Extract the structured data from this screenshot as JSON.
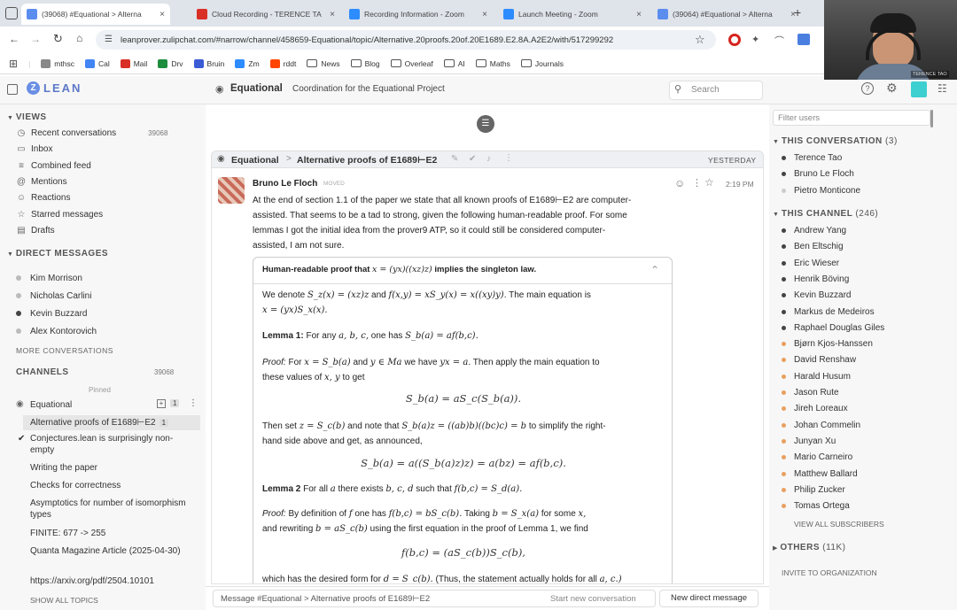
{
  "browser": {
    "tabs": [
      {
        "title": "(39068) #Equational > Alterna",
        "fav": "#5b8def"
      },
      {
        "title": "Cloud Recording - TERENCE TA",
        "fav": "#d93025"
      },
      {
        "title": "Recording Information - Zoom",
        "fav": "#2d8cff"
      },
      {
        "title": "Launch Meeting - Zoom",
        "fav": "#2d8cff"
      },
      {
        "title": "(39064) #Equational > Alterna",
        "fav": "#5b8def"
      }
    ],
    "new_tab": "+",
    "url": "leanprover.zulipchat.com/#narrow/channel/458659-Equational/topic/Alternative.20proofs.20of.20E1689.E2.8A.A2E2/with/517299292",
    "bookmarks": [
      "mthsc",
      "Cal",
      "Mail",
      "Drv",
      "Bruin",
      "Zm",
      "rddt",
      "News",
      "Blog",
      "Overleaf",
      "AI",
      "Maths",
      "Journals"
    ],
    "video_label": "TERENCE TAO"
  },
  "header": {
    "logo": "LEAN",
    "channel": "Equational",
    "description": "Coordination for the Equational Project",
    "search_placeholder": "Search"
  },
  "left": {
    "views_heading": "VIEWS",
    "views": [
      {
        "label": "Recent conversations",
        "icon": "clock-icon",
        "glyph": "◷",
        "count": "39068"
      },
      {
        "label": "Inbox",
        "icon": "inbox-icon",
        "glyph": "▭"
      },
      {
        "label": "Combined feed",
        "icon": "feed-icon",
        "glyph": "≡"
      },
      {
        "label": "Mentions",
        "icon": "at-icon",
        "glyph": "@"
      },
      {
        "label": "Reactions",
        "icon": "smile-icon",
        "glyph": "☺"
      },
      {
        "label": "Starred messages",
        "icon": "star-icon",
        "glyph": "☆"
      },
      {
        "label": "Drafts",
        "icon": "drafts-icon",
        "glyph": "▤"
      }
    ],
    "dm_heading": "DIRECT MESSAGES",
    "dms": [
      {
        "name": "Kim Morrison",
        "status": "#bbb"
      },
      {
        "name": "Nicholas Carlini",
        "status": "#bbb"
      },
      {
        "name": "Kevin Buzzard",
        "status": "#444"
      },
      {
        "name": "Alex Kontorovich",
        "status": "#bbb"
      }
    ],
    "more_conversations": "MORE CONVERSATIONS",
    "channels_heading": "CHANNELS",
    "channels_count": "39068",
    "pinned": "Pinned",
    "channel_name": "Equational",
    "channel_badge": "1",
    "topics": [
      {
        "label": "Alternative proofs of E1689⊢E2",
        "count": "1",
        "active": true
      },
      {
        "label": "Conjectures.lean is surprisingly non-empty",
        "check": true
      },
      {
        "label": "Writing the paper"
      },
      {
        "label": "Checks for correctness"
      },
      {
        "label": "Asymptotics for number of isomorphism types"
      },
      {
        "label": "FINITE: 677 -> 255"
      },
      {
        "label": "Quanta Magazine Article (2025-04-30)"
      },
      {
        "label": "https://arxiv.org/pdf/2504.10101"
      }
    ],
    "show_all_topics": "SHOW ALL TOPICS"
  },
  "center": {
    "recipient_channel": "Equational",
    "recipient_topic": "Alternative proofs of E1689⊢E2",
    "date": "YESTERDAY",
    "sender": "Bruno Le Floch",
    "sender_role": "MOVED",
    "time": "2:19 PM",
    "para1": [
      "At the end of section 1.1 of the paper we state that all known proofs of E1689⊢E2 are computer-",
      "assisted. That seems to be a tad to strong, given the following human-readable proof. For some",
      "lemmas I got the initial idea from the prover9 ATP, so it could still be considered computer-",
      "assisted, I am not sure."
    ],
    "proof_title_a": "Human-readable proof that",
    "proof_title_math": "x = (yx)((xz)z)",
    "proof_title_b": "implies the singleton law.",
    "l1a": "We denote",
    "l1m1": "S_z(x) = (xz)z",
    "l1b": "and",
    "l1m2": "f(x,y) = xS_y(x) = x((xy)y)",
    "l1c": ". The main equation is",
    "l2m": "x = (yx)S_x(x).",
    "lem1_label": "Lemma 1:",
    "lem1a": "For any",
    "lem1m1": "a, b, c,",
    "lem1b": "one has",
    "lem1m2": "S_b(a) = af(b,c).",
    "pf1_label": "Proof:",
    "pf1a": "For",
    "pf1m1": "x = S_b(a)",
    "pf1b": "and",
    "pf1m2": "y ∈ Ma",
    "pf1c": "we have",
    "pf1m3": "yx = a",
    "pf1d": ". Then apply the main equation to",
    "pf1e": "these values of",
    "pf1m4": "x, y",
    "pf1f": "to get",
    "eq1": "S_b(a) = aS_c(S_b(a)).",
    "then_a": "Then set",
    "then_m1": "z = S_c(b)",
    "then_b": "and note that",
    "then_m2": "S_b(a)z = ((ab)b)((bc)c) = b",
    "then_c": "to simplify the right-",
    "then_d": "hand side above and get, as announced,",
    "eq2": "S_b(a) = a((S_b(a)z)z) = a(bz) = af(b,c).",
    "lem2_label": "Lemma 2",
    "lem2a": "For all",
    "lem2m1": "a",
    "lem2b": "there exists",
    "lem2m2": "b, c, d",
    "lem2c": "such that",
    "lem2m3": "f(b,c) = S_d(a).",
    "pf2_label": "Proof:",
    "pf2a": "By definition of",
    "pf2m1": "f",
    "pf2b": "one has",
    "pf2m2": "f(b,c) = bS_c(b).",
    "pf2c": "Taking",
    "pf2m3": "b = S_x(a)",
    "pf2d": "for some",
    "pf2m4": "x,",
    "pf2e": "and rewriting",
    "pf2m5": "b = aS_c(b)",
    "pf2f": "using the first equation in the proof of Lemma 1, we find",
    "eq3": "f(b,c) = (aS_c(b))S_c(b),",
    "last_a": "which has the desired form for",
    "last_m1": "d = S_c(b).",
    "last_b": "(Thus, the statement actually holds for all",
    "last_m2": "a, c.)"
  },
  "compose": {
    "placeholder": "Message #Equational > Alternative proofs of E1689⊢E2",
    "start_new": "Start new conversation",
    "new_dm": "New direct message"
  },
  "right": {
    "filter_placeholder": "Filter users",
    "this_conv": "THIS CONVERSATION",
    "this_conv_count": "(3)",
    "conv_users": [
      {
        "name": "Terence Tao",
        "status": "#444"
      },
      {
        "name": "Bruno Le Floch",
        "status": "#444"
      },
      {
        "name": "Pietro Monticone",
        "status": "#ccc"
      }
    ],
    "this_channel": "THIS CHANNEL",
    "this_channel_count": "(246)",
    "channel_users": [
      {
        "name": "Andrew Yang",
        "status": "#444"
      },
      {
        "name": "Ben Eltschig",
        "status": "#444"
      },
      {
        "name": "Eric Wieser",
        "status": "#444"
      },
      {
        "name": "Henrik Böving",
        "status": "#444"
      },
      {
        "name": "Kevin Buzzard",
        "status": "#444"
      },
      {
        "name": "Markus de Medeiros",
        "status": "#444"
      },
      {
        "name": "Raphael Douglas Giles",
        "status": "#444"
      },
      {
        "name": "Bjørn Kjos-Hanssen",
        "status": "#e8a060"
      },
      {
        "name": "David Renshaw",
        "status": "#e8a060"
      },
      {
        "name": "Harald Husum",
        "status": "#e8a060"
      },
      {
        "name": "Jason Rute",
        "status": "#e8a060"
      },
      {
        "name": "Jireh Loreaux",
        "status": "#e8a060"
      },
      {
        "name": "Johan Commelin",
        "status": "#e8a060"
      },
      {
        "name": "Junyan Xu",
        "status": "#e8a060"
      },
      {
        "name": "Mario Carneiro",
        "status": "#e8a060"
      },
      {
        "name": "Matthew Ballard",
        "status": "#e8a060"
      },
      {
        "name": "Philip Zucker",
        "status": "#e8a060"
      },
      {
        "name": "Tomas Ortega",
        "status": "#e8a060"
      }
    ],
    "view_all": "VIEW ALL SUBSCRIBERS",
    "others": "OTHERS",
    "others_count": "(11K)",
    "invite": "INVITE TO ORGANIZATION"
  }
}
